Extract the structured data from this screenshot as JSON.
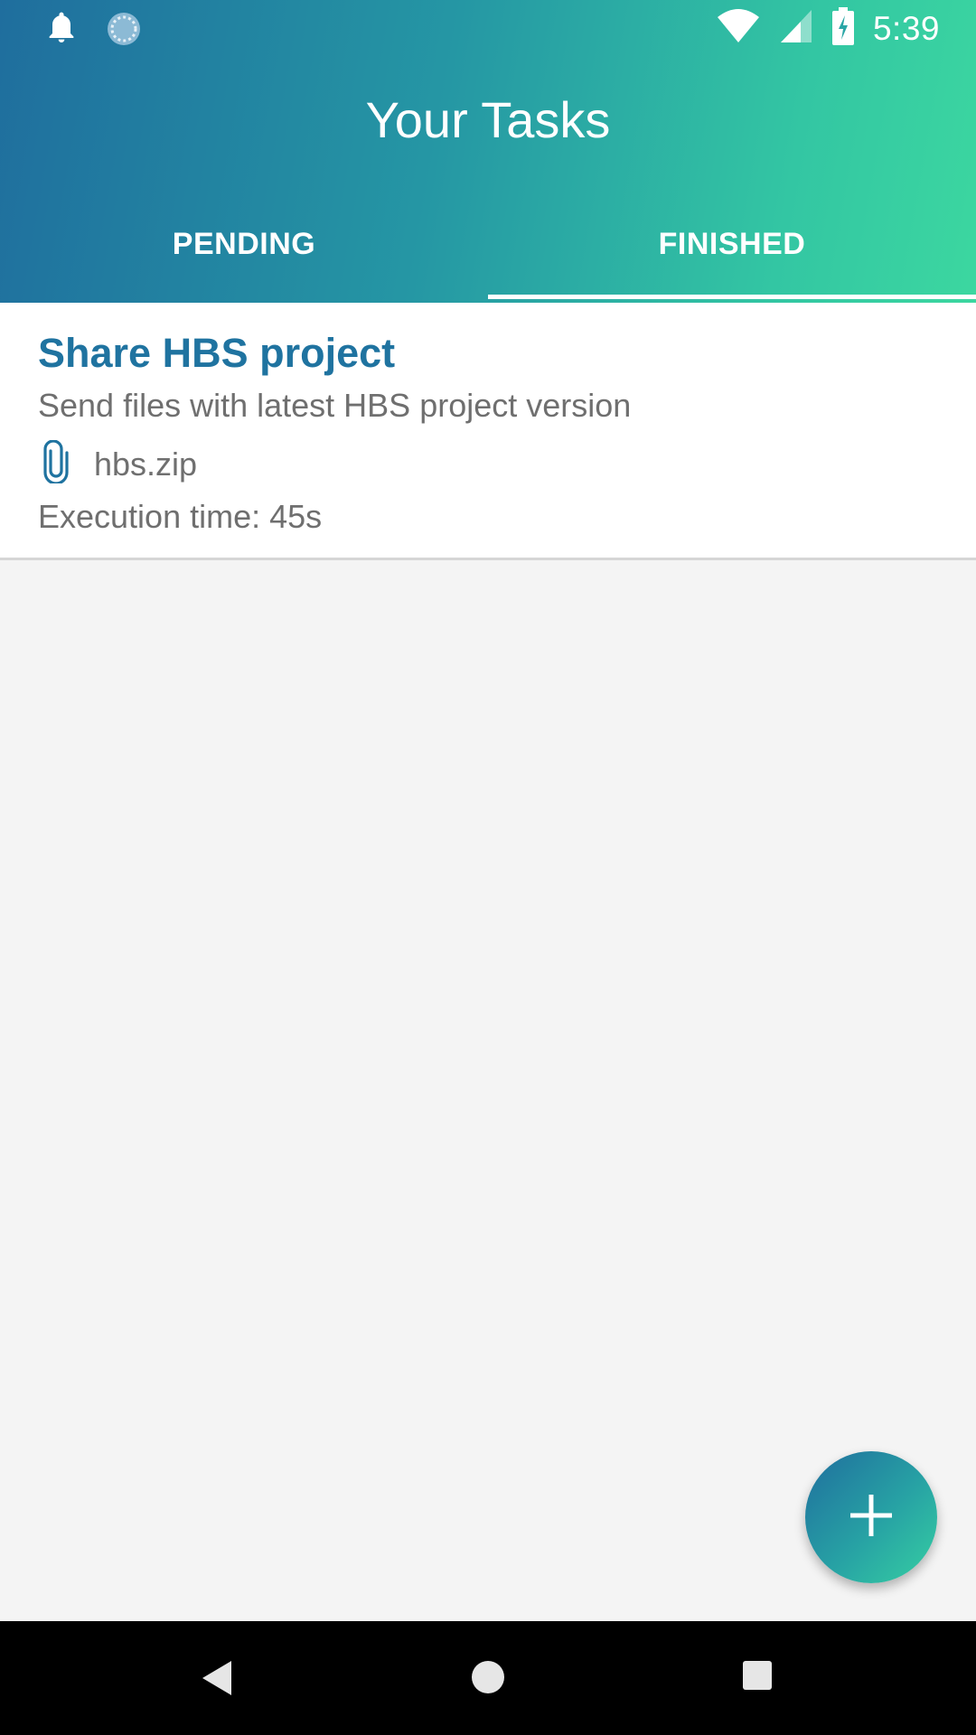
{
  "status_bar": {
    "time": "5:39",
    "left_icons": [
      "bell-icon",
      "sync-icon"
    ],
    "right_icons": [
      "wifi-icon",
      "signal-icon",
      "battery-charging-icon"
    ]
  },
  "app_bar": {
    "title": "Your Tasks"
  },
  "tabs": [
    {
      "label": "PENDING",
      "selected": false
    },
    {
      "label": "FINISHED",
      "selected": true
    }
  ],
  "tasks": [
    {
      "title": "Share HBS project",
      "description": "Send files with latest HBS project version",
      "attachment": "hbs.zip",
      "execution_time": "Execution time: 45s"
    }
  ],
  "fab": {
    "icon": "plus-icon"
  },
  "nav_bar": {
    "icons": [
      "back-icon",
      "home-icon",
      "recents-icon"
    ]
  },
  "colors": {
    "accent": "#1f73a0",
    "gradient_start": "#1f6e9e",
    "gradient_end": "#3cd7a0",
    "background": "#f4f4f4",
    "secondary_text": "#6f6f6f"
  }
}
